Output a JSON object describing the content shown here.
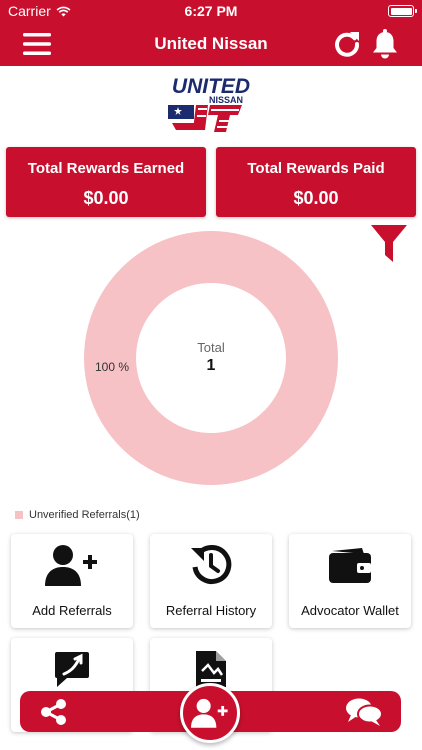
{
  "status_bar": {
    "carrier": "Carrier",
    "time": "6:27 PM"
  },
  "header": {
    "title": "United Nissan"
  },
  "logo": {
    "top_text": "UNITED",
    "bottom_text": "NISSAN"
  },
  "rewards": {
    "earned": {
      "label": "Total Rewards Earned",
      "value": "$0.00"
    },
    "paid": {
      "label": "Total Rewards Paid",
      "value": "$0.00"
    }
  },
  "chart_data": {
    "type": "pie",
    "style": "donut",
    "categories": [
      "Unverified Referrals"
    ],
    "values": [
      1
    ],
    "percent_labels": [
      "100 %"
    ],
    "center_label": "Total",
    "center_value": "1",
    "legend": [
      "Unverified Referrals(1)"
    ],
    "legend_placement": "bottom-left",
    "colors": [
      "#f6c2c6"
    ]
  },
  "tiles": [
    {
      "label": "Add Referrals",
      "icon": "user-plus-icon"
    },
    {
      "label": "Referral History",
      "icon": "history-icon"
    },
    {
      "label": "Advocator Wallet",
      "icon": "wallet-icon"
    },
    {
      "label": "",
      "icon": "chat-square-icon"
    },
    {
      "label": "",
      "icon": "document-icon"
    }
  ],
  "colors": {
    "brand": "#c8102e",
    "donut": "#f6c2c6",
    "page": "#ffffff"
  }
}
